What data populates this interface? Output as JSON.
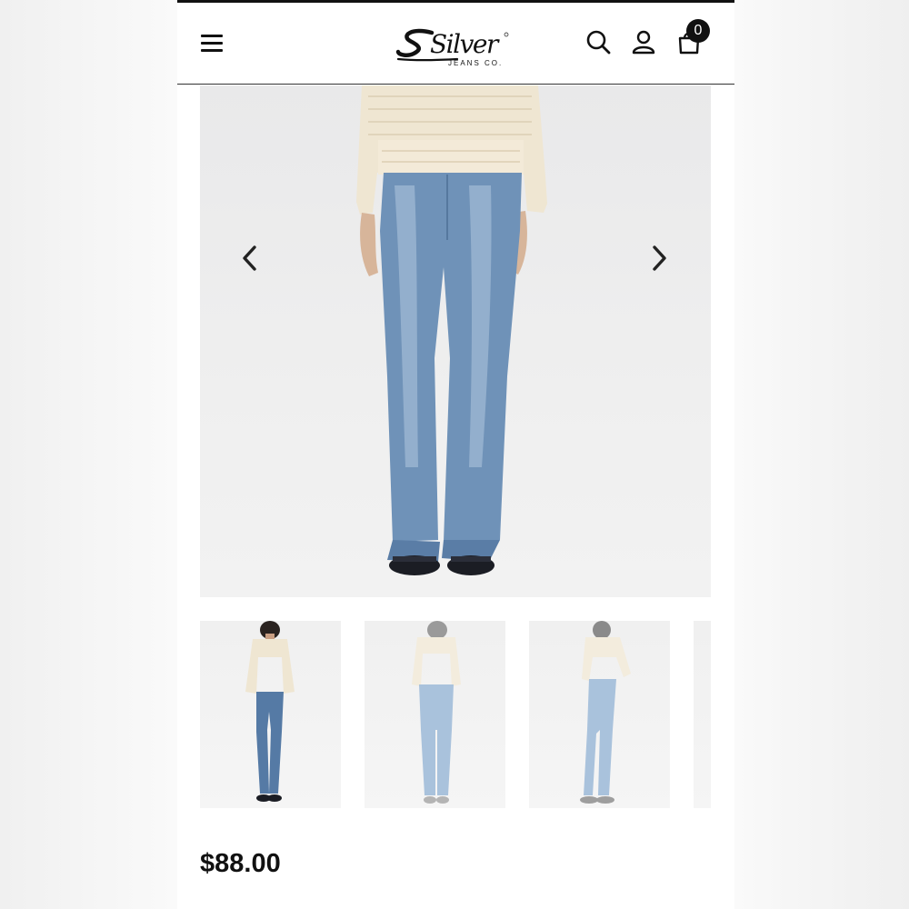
{
  "header": {
    "brand_name": "Silver",
    "brand_sub": "JEANS CO.",
    "cart_count": "0",
    "icons": [
      "menu-icon",
      "search-icon",
      "account-icon",
      "cart-icon"
    ]
  },
  "gallery": {
    "prev_icon": "chevron-left-icon",
    "next_icon": "chevron-right-icon",
    "thumbnail_count": 4
  },
  "product": {
    "price": "$88.00"
  },
  "colors": {
    "header_border": "#333333",
    "text": "#111111",
    "sweater": "#efe6d2",
    "denim_mid": "#6f92b8",
    "denim_light": "#a9c2dc"
  }
}
